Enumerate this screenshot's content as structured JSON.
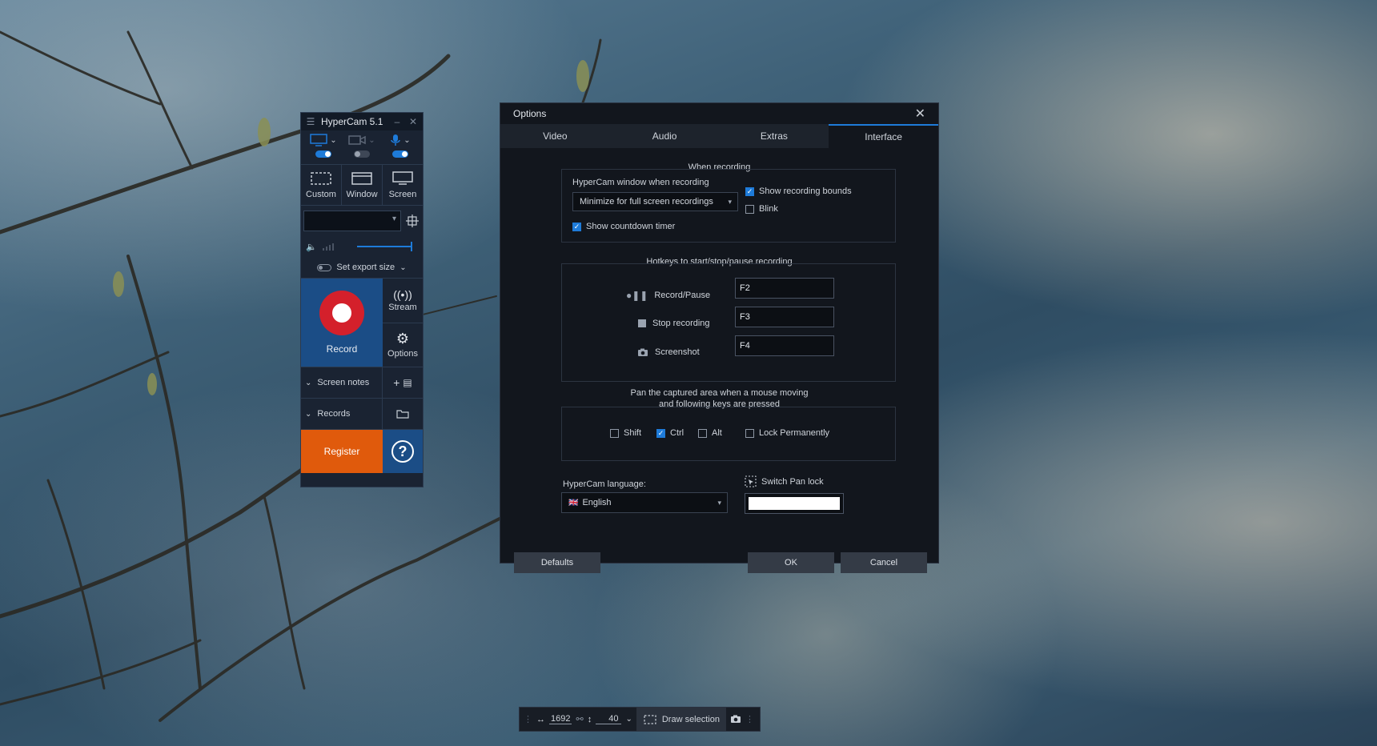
{
  "hypercam": {
    "title": "HyperCam 5.1",
    "modes": [
      "Custom",
      "Window",
      "Screen"
    ],
    "export_label": "Set export size",
    "record_label": "Record",
    "stream_label": "Stream",
    "options_label": "Options",
    "screen_notes_label": "Screen notes",
    "records_label": "Records",
    "register_label": "Register",
    "help_symbol": "?",
    "volume_level_percent": 100
  },
  "options": {
    "title": "Options",
    "close_symbol": "✕",
    "tabs": [
      "Video",
      "Audio",
      "Extras",
      "Interface"
    ],
    "active_tab": "Interface",
    "when_recording": {
      "legend": "When recording",
      "window_label": "HyperCam window when recording",
      "window_select": "Minimize for full screen recordings",
      "show_bounds": "Show recording bounds",
      "blink": "Blink",
      "countdown": "Show countdown timer"
    },
    "hotkeys": {
      "legend": "Hotkeys to start/stop/pause recording",
      "items": [
        {
          "label": "Record/Pause",
          "value": "F2"
        },
        {
          "label": "Stop recording",
          "value": "F3"
        },
        {
          "label": "Screenshot",
          "value": "F4"
        }
      ]
    },
    "pan": {
      "legend_line1": "Pan the captured area when a mouse moving",
      "legend_line2": "and following keys are pressed",
      "shift": "Shift",
      "ctrl": "Ctrl",
      "alt": "Alt",
      "lock": "Lock Permanently"
    },
    "language_label": "HyperCam language:",
    "language_flag": "🇬🇧",
    "language_value": "English",
    "switch_pan_label": "Switch Pan lock",
    "defaults_btn": "Defaults",
    "ok_btn": "OK",
    "cancel_btn": "Cancel"
  },
  "toolbar": {
    "width_value": "1692",
    "height_value": "40",
    "draw_label": "Draw selection"
  }
}
